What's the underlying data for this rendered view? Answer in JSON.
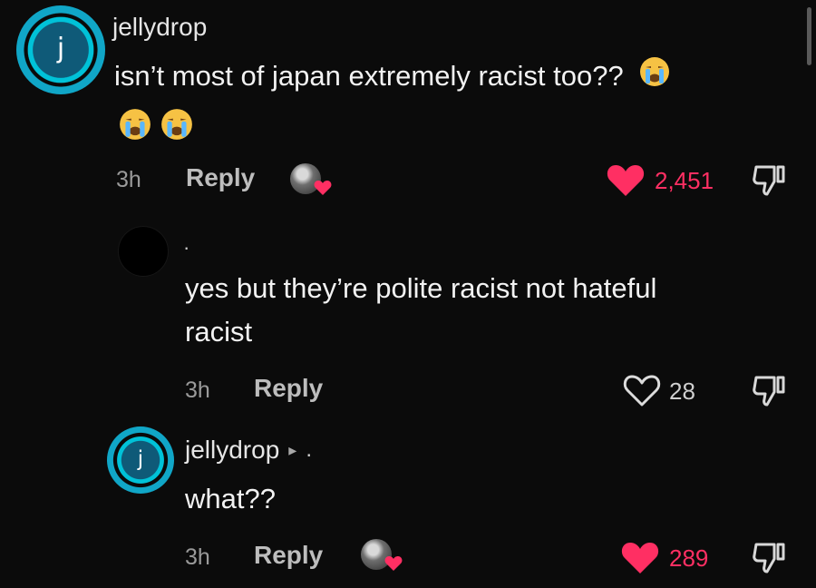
{
  "comments": {
    "top": {
      "avatar_letter": "j",
      "username": "jellydrop",
      "text_line1": "isn’t most of japan extremely racist too??",
      "time": "3h",
      "reply_label": "Reply",
      "likes": "2,451",
      "liked": true
    },
    "reply1": {
      "username_dot": "·",
      "text_line1": "yes but they’re polite racist not hateful",
      "text_line2": "racist",
      "time": "3h",
      "reply_label": "Reply",
      "likes": "28",
      "liked": false
    },
    "reply2": {
      "avatar_letter": "j",
      "username": "jellydrop",
      "arrow": "▸",
      "dot": ".",
      "text_line1": "what??",
      "time": "3h",
      "reply_label": "Reply",
      "likes": "289",
      "liked": true
    }
  },
  "colors": {
    "like_red": "#ff2f63",
    "avatar_teal": "#10a6c7"
  }
}
